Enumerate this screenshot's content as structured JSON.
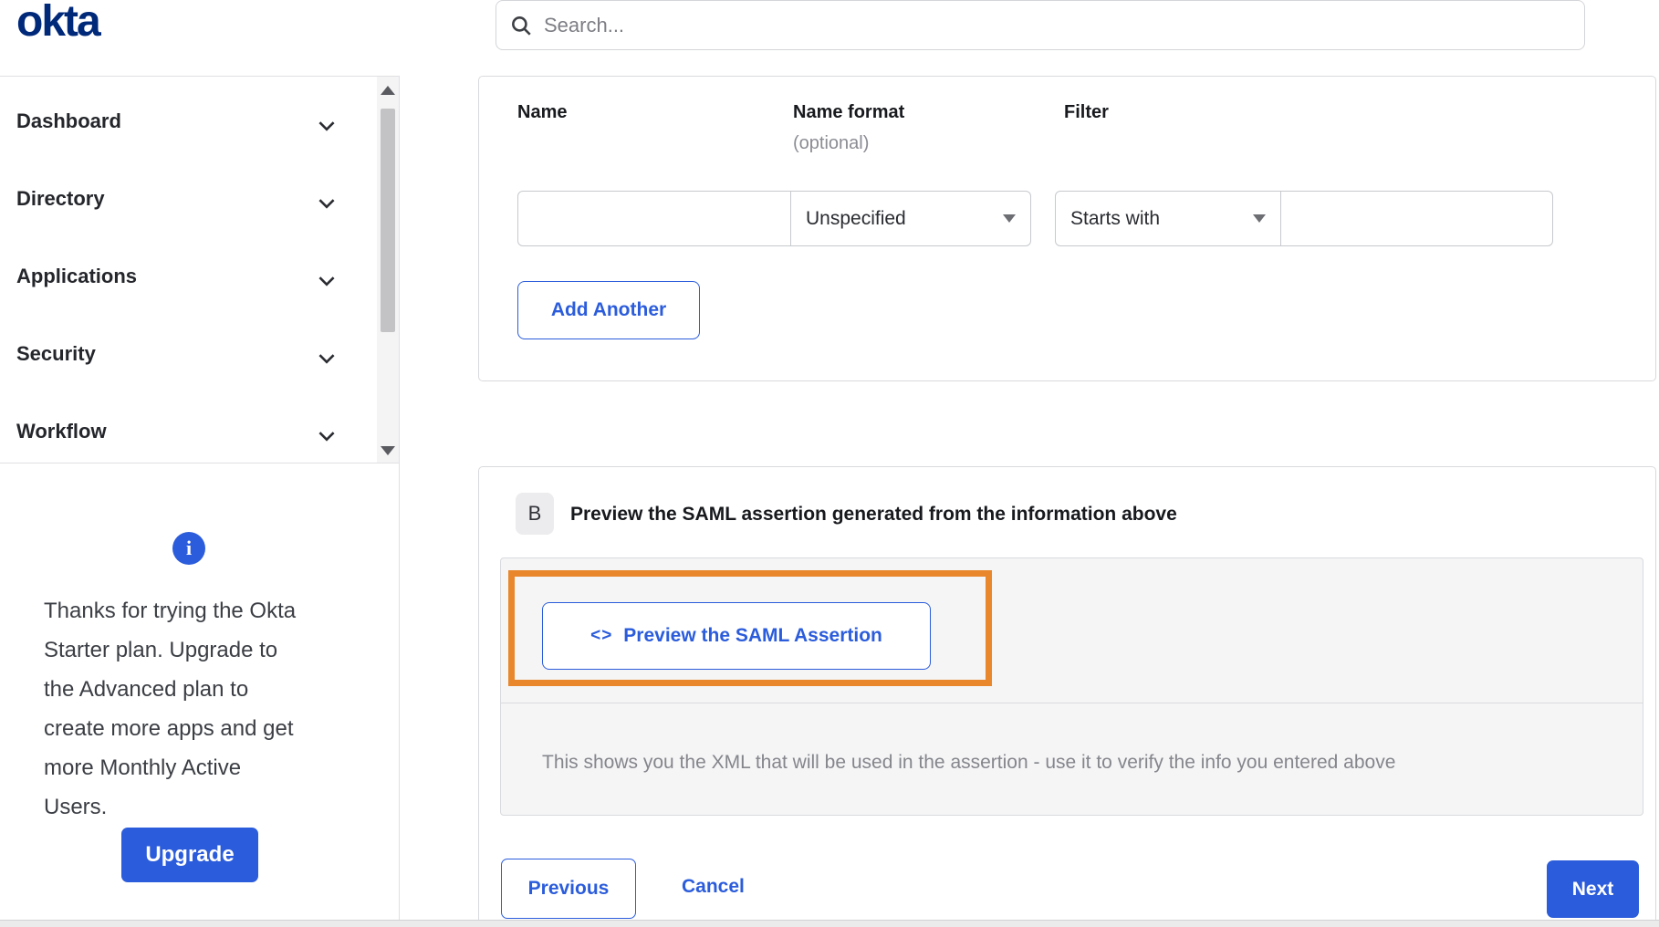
{
  "app": {
    "logo_text": "okta"
  },
  "topbar": {
    "search_placeholder": "Search..."
  },
  "sidebar": {
    "items": [
      {
        "label": "Dashboard"
      },
      {
        "label": "Directory"
      },
      {
        "label": "Applications"
      },
      {
        "label": "Security"
      },
      {
        "label": "Workflow"
      }
    ],
    "upsell": {
      "message": "Thanks for trying the Okta Starter plan. Upgrade to the Advanced plan to create more apps and get more Monthly Active Users.",
      "upgrade_label": "Upgrade"
    }
  },
  "attribute_form": {
    "headers": {
      "name": "Name",
      "name_format": "Name format",
      "name_format_hint": "(optional)",
      "filter": "Filter"
    },
    "row": {
      "name_value": "",
      "name_format_selected": "Unspecified",
      "filter_operator_selected": "Starts with",
      "filter_value": ""
    },
    "add_another_label": "Add Another"
  },
  "preview_section": {
    "badge": "B",
    "heading": "Preview the SAML assertion generated from the information above",
    "preview_button_icon": "<>",
    "preview_button_label": "Preview the SAML Assertion",
    "description": "This shows you the XML that will be used in the assertion - use it to verify the info you entered above"
  },
  "wizard_footer": {
    "previous_label": "Previous",
    "cancel_label": "Cancel",
    "next_label": "Next"
  },
  "icons": {
    "search": "search-icon",
    "chevron": "chevron-down-icon",
    "info": "info-icon",
    "code": "code-icon",
    "select_caret": "caret-down-icon",
    "scroll_up": "scroll-up-arrow-icon",
    "scroll_down": "scroll-down-arrow-icon"
  },
  "colors": {
    "brand_navy": "#00297A",
    "accent_blue": "#2b5cdb",
    "highlight_orange": "#E8872B",
    "panel_gray": "#f5f5f6",
    "muted_text": "#85868c",
    "border_gray": "#d9dadd"
  }
}
